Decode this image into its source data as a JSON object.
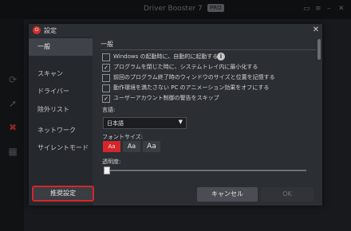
{
  "app": {
    "title": "Driver Booster 7",
    "badge": "PRO",
    "titlebar_icons": [
      "chat-icon",
      "menu-icon",
      "minimize-icon",
      "maximize-icon",
      "close-icon"
    ],
    "sidebar_icons": [
      "refresh-icon",
      "rocket-icon",
      "tools-icon",
      "grid-icon"
    ]
  },
  "dialog": {
    "title": "設定",
    "close_glyph": "✕",
    "nav": [
      "一般",
      "スキャン",
      "ドライバー",
      "除外リスト",
      "ネットワーク",
      "サイレントモード"
    ],
    "section_title": "一般",
    "options": [
      {
        "label": "Windows の起動時に、自動的に起動する",
        "checked": false,
        "info": true
      },
      {
        "label": "プログラムを閉じた時に、システムトレイ内に最小化する",
        "checked": true
      },
      {
        "label": "前回のプログラム終了時のウィンドウのサイズと位置を記憶する",
        "checked": false
      },
      {
        "label": "動作環境を満たさない PC のアニメーション効果をオフにする",
        "checked": false
      },
      {
        "label": "ユーザーアカウント制御の警告をスキップ",
        "checked": true
      }
    ],
    "language_label": "言語:",
    "language_value": "日本語",
    "font_size_label": "フォントサイズ:",
    "font_sizes": [
      "Aa",
      "Aa",
      "Aa"
    ],
    "transparency_label": "透明度:",
    "transparency_value": 0,
    "buttons": {
      "recommended": "推奨設定",
      "cancel": "キャンセル",
      "ok": "OK"
    }
  },
  "colors": {
    "accent_red": "#d4262b",
    "dialog_bg": "#2b2e33",
    "nav_bg": "#25282c"
  }
}
